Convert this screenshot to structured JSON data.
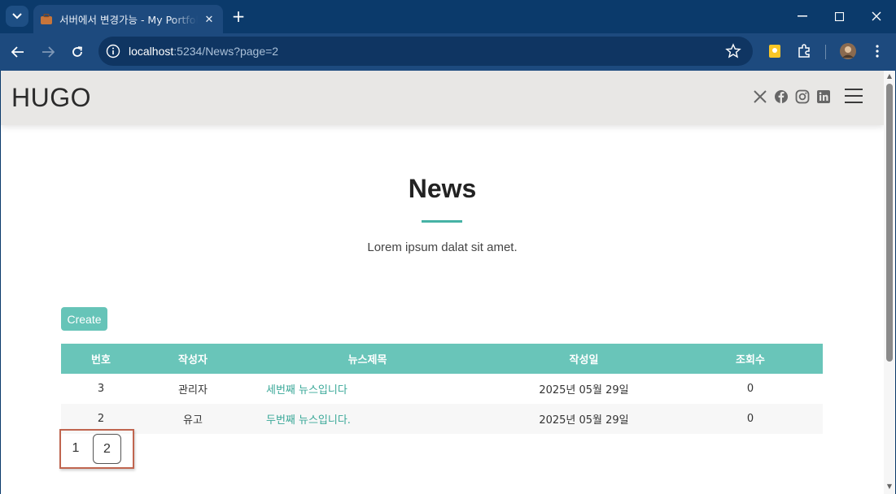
{
  "browser": {
    "tab_title": "서버에서 변경가능 - My Portfolio",
    "url_host": "localhost",
    "url_path": ":5234/News?page=2"
  },
  "site": {
    "logo": "HUGO",
    "social_icons": [
      "x-icon",
      "facebook-icon",
      "instagram-icon",
      "linkedin-icon"
    ]
  },
  "section": {
    "title": "News",
    "subtitle": "Lorem ipsum dalat sit amet.",
    "create_label": "Create"
  },
  "table": {
    "headers": [
      "번호",
      "작성자",
      "뉴스제목",
      "작성일",
      "조회수"
    ],
    "rows": [
      {
        "no": "3",
        "author": "관리자",
        "title": "세번째 뉴스입니다",
        "date": "2025년 05월 29일",
        "views": "0"
      },
      {
        "no": "2",
        "author": "유고",
        "title": "두번째 뉴스입니다.",
        "date": "2025년 05월 29일",
        "views": "0"
      }
    ]
  },
  "pagination": {
    "pages": [
      "1",
      "2"
    ],
    "current": "2"
  },
  "colors": {
    "accent": "#69c5b9",
    "link": "#3aa898",
    "highlight_border": "#c0654f"
  }
}
